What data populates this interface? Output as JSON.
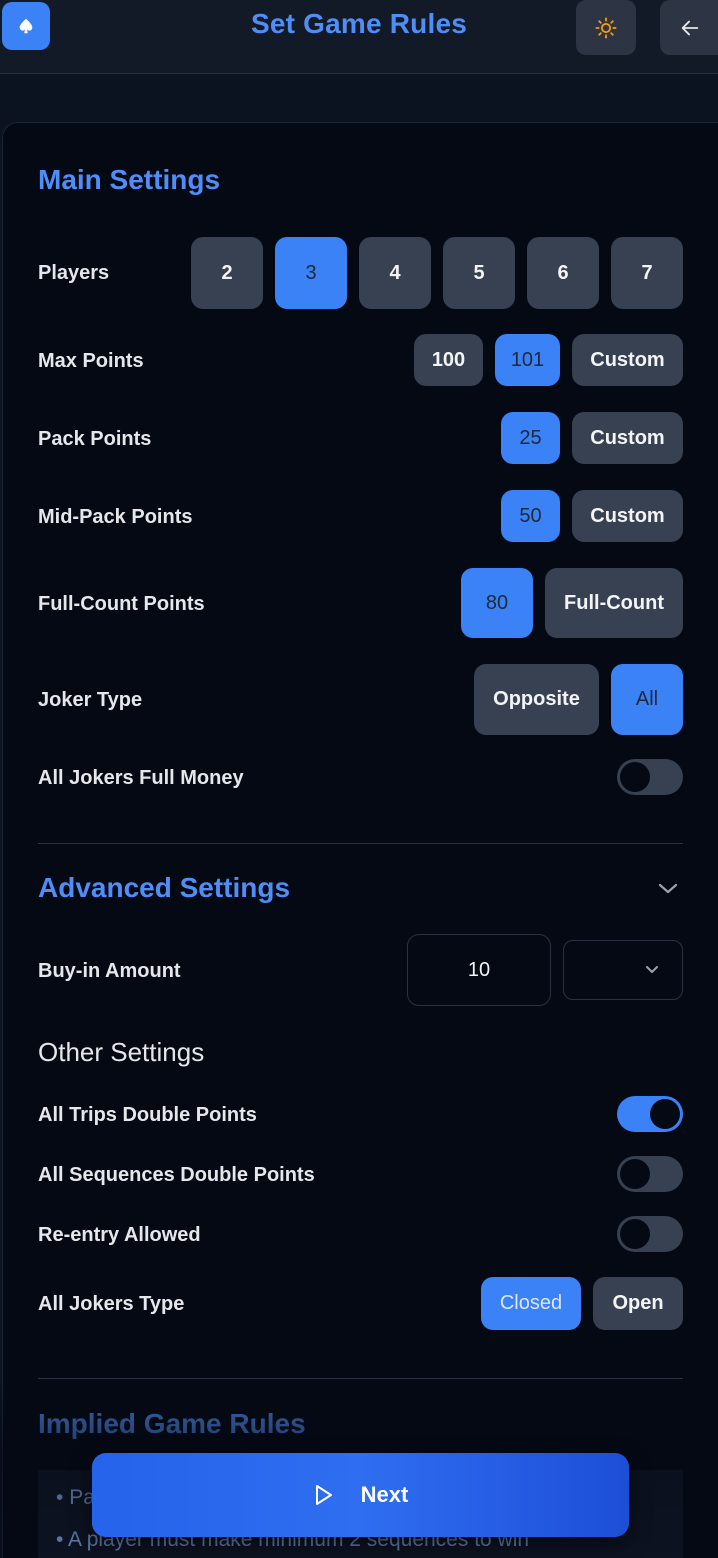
{
  "header": {
    "title": "Set Game Rules",
    "logo_icon": "spade-icon",
    "theme_icon": "sun-icon",
    "back_icon": "arrow-left-icon"
  },
  "main_settings": {
    "title": "Main Settings",
    "players": {
      "label": "Players",
      "options": [
        "2",
        "3",
        "4",
        "5",
        "6",
        "7"
      ],
      "selected": "3"
    },
    "max_points": {
      "label": "Max Points",
      "options": [
        "100",
        "101",
        "Custom"
      ],
      "selected": "101"
    },
    "pack_points": {
      "label": "Pack Points",
      "options": [
        "25",
        "Custom"
      ],
      "selected": "25"
    },
    "mid_pack_points": {
      "label": "Mid-Pack Points",
      "options": [
        "50",
        "Custom"
      ],
      "selected": "50"
    },
    "full_count_points": {
      "label": "Full-Count Points",
      "options": [
        "80",
        "Full-Count"
      ],
      "selected": "80"
    },
    "joker_type": {
      "label": "Joker Type",
      "options": [
        "Opposite",
        "All"
      ],
      "selected": "All"
    },
    "all_jokers_full_money": {
      "label": "All Jokers Full Money",
      "on": false
    }
  },
  "advanced_settings": {
    "title": "Advanced Settings",
    "buy_in": {
      "label": "Buy-in Amount",
      "value": "10",
      "currency": ""
    }
  },
  "other_settings": {
    "title": "Other Settings",
    "all_trips_double": {
      "label": "All Trips Double Points",
      "on": true
    },
    "all_sequences_double": {
      "label": "All Sequences Double Points",
      "on": false
    },
    "re_entry": {
      "label": "Re-entry Allowed",
      "on": false
    },
    "all_jokers_type": {
      "label": "All Jokers Type",
      "options": [
        "Closed",
        "Open"
      ],
      "selected": "Closed"
    }
  },
  "implied_rules": {
    "title": "Implied Game Rules",
    "items": [
      "Pa",
      "A player must make minimum 2 sequences to win"
    ]
  },
  "footer": {
    "next_label": "Next",
    "next_icon": "play-icon"
  },
  "colors": {
    "accent": "#3b82f6",
    "background": "#050914",
    "header": "#131a27"
  }
}
